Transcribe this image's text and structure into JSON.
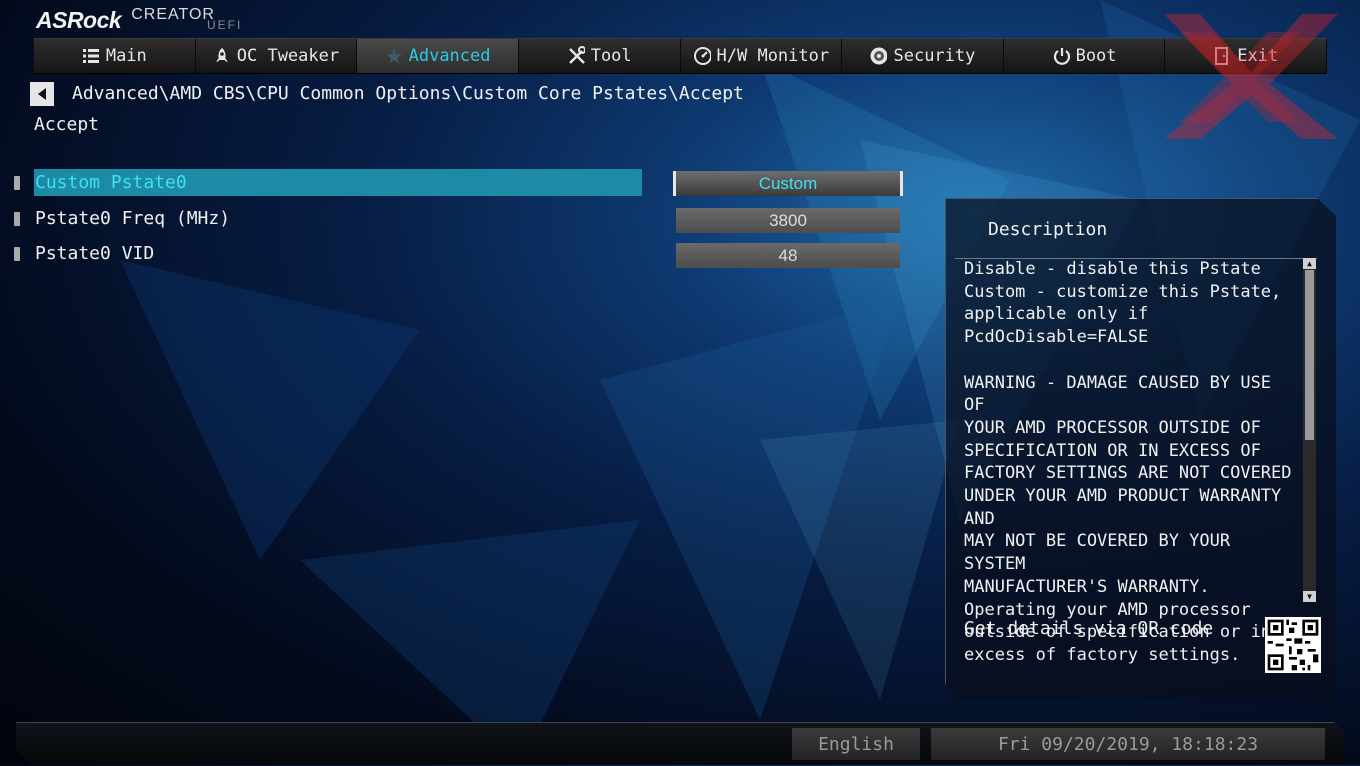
{
  "brand": {
    "name": "ASRock",
    "product": "CREATOR",
    "firmware": "UEFI"
  },
  "nav": {
    "tabs": [
      {
        "label": "Main",
        "icon": "list-icon",
        "active": false
      },
      {
        "label": "OC Tweaker",
        "icon": "rocket-icon",
        "active": false
      },
      {
        "label": "Advanced",
        "icon": "star-icon",
        "active": true
      },
      {
        "label": "Tool",
        "icon": "tools-icon",
        "active": false
      },
      {
        "label": "H/W Monitor",
        "icon": "gauge-icon",
        "active": false
      },
      {
        "label": "Security",
        "icon": "shield-icon",
        "active": false
      },
      {
        "label": "Boot",
        "icon": "power-icon",
        "active": false
      },
      {
        "label": "Exit",
        "icon": "exit-door-icon",
        "active": false
      }
    ]
  },
  "breadcrumb": "Advanced\\AMD CBS\\CPU Common Options\\Custom Core Pstates\\Accept",
  "subtitle": "Accept",
  "settings": [
    {
      "label": "Custom Pstate0",
      "value": "Custom",
      "selected": true
    },
    {
      "label": "Pstate0 Freq (MHz)",
      "value": "3800",
      "selected": false
    },
    {
      "label": "Pstate0 VID",
      "value": "48",
      "selected": false
    }
  ],
  "description": {
    "title": "Description",
    "text": "Disable - disable this Pstate\nCustom - customize this Pstate,\napplicable only if\nPcdOcDisable=FALSE\n\nWARNING - DAMAGE CAUSED BY USE OF\nYOUR AMD PROCESSOR OUTSIDE OF\nSPECIFICATION OR IN EXCESS OF\nFACTORY SETTINGS ARE NOT COVERED\nUNDER YOUR AMD PRODUCT WARRANTY AND\nMAY NOT BE COVERED BY YOUR SYSTEM\nMANUFACTURER'S WARRANTY.\nOperating your AMD processor\noutside of specification or in\nexcess of factory settings.",
    "qr_label": "Get details via QR code"
  },
  "footer": {
    "language": "English",
    "datetime": "Fri 09/20/2019, 18:18:23"
  },
  "colors": {
    "accent": "#2ec8e6",
    "selected_row": "#1d8aa6",
    "watermark": "#d8232a"
  }
}
